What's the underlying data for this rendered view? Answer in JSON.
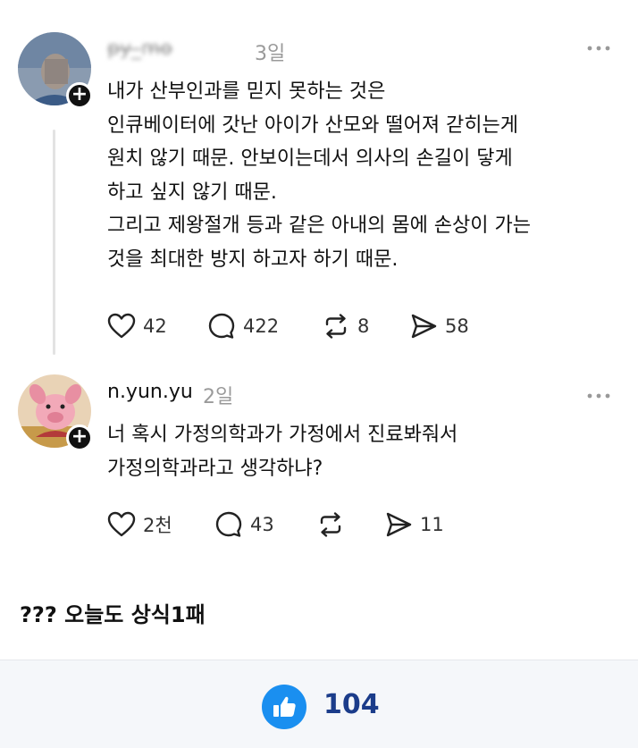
{
  "posts": [
    {
      "username": "p̶y̶_̶m̶o̶",
      "time": "3일",
      "more_icon": "more-horizontal-icon",
      "lines": [
        "내가 산부인과를 믿지 못하는 것은",
        "인큐베이터에 갓난 아이가 산모와 떨어져 갇히는게",
        "원치 않기 때문. 안보이는데서 의사의 손길이 닿게",
        "하고 싶지 않기 때문.",
        "그리고 제왕절개 등과 같은 아내의 몸에 손상이 가는",
        "것을 최대한 방지 하고자 하기 때문."
      ],
      "likes": "42",
      "comments": "422",
      "reposts": "8",
      "shares": "58"
    },
    {
      "username": "n.yun.yu",
      "time": "2일",
      "more_icon": "more-horizontal-icon",
      "lines": [
        "너 혹시 가정의학과가 가정에서 진료봐줘서",
        "가정의학과라고 생각하냐?"
      ],
      "likes": "2천",
      "comments": "43",
      "reposts": "",
      "shares": "11"
    }
  ],
  "caption": "??? 오늘도 상식1패",
  "like_bar": {
    "count": "104",
    "icon": "thumbs-up-icon",
    "accent": "#1a8ff0"
  }
}
